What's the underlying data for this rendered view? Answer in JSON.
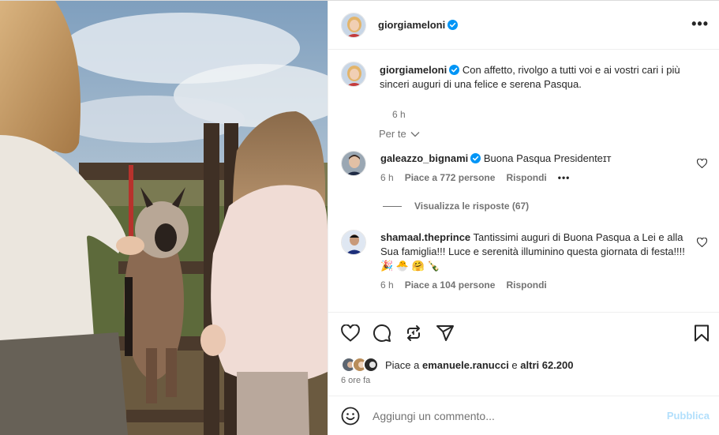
{
  "post": {
    "author": "giorgiameloni",
    "more_label": "•••"
  },
  "caption": {
    "username": "giorgiameloni",
    "text": " Con affetto, rivolgo a tutti voi e ai vostri cari i più sinceri auguri di una felice e serena Pasqua.",
    "time": "6 h"
  },
  "filter": {
    "label": "Per te"
  },
  "comments": [
    {
      "username": "galeazzo_bignami",
      "text": " Buona Pasqua Presidenteɪᴛ",
      "time": "6 h",
      "likes": "Piace a 772 persone",
      "reply": "Rispondi",
      "more": "•••",
      "view_replies": "Visualizza le risposte (67)"
    },
    {
      "username": "shamaal.theprince",
      "text": " Tantissimi auguri di Buona Pasqua a Lei e alla Sua famiglia!!! Luce e serenità illuminino questa giornata di festa!!!! 🎉 🐣 🤗 🍾",
      "time": "6 h",
      "likes": "Piace a 104 persone",
      "reply": "Rispondi"
    }
  ],
  "likes_summary": {
    "prefix": "Piace a ",
    "user": "emanuele.ranucci",
    "middle": " e ",
    "others": "altri 62.200"
  },
  "post_age": "6 ore fa",
  "composer": {
    "placeholder": "Aggiungi un commento...",
    "publish": "Pubblica"
  },
  "colors": {
    "verified": "#0095f6",
    "publish_disabled": "#b2dffc",
    "secondary_text": "#737373"
  },
  "icons": [
    "heart-icon",
    "comment-icon",
    "share-icon",
    "send-icon",
    "bookmark-icon",
    "emoji-icon",
    "chevron-down-icon",
    "verified-icon",
    "more-icon"
  ]
}
